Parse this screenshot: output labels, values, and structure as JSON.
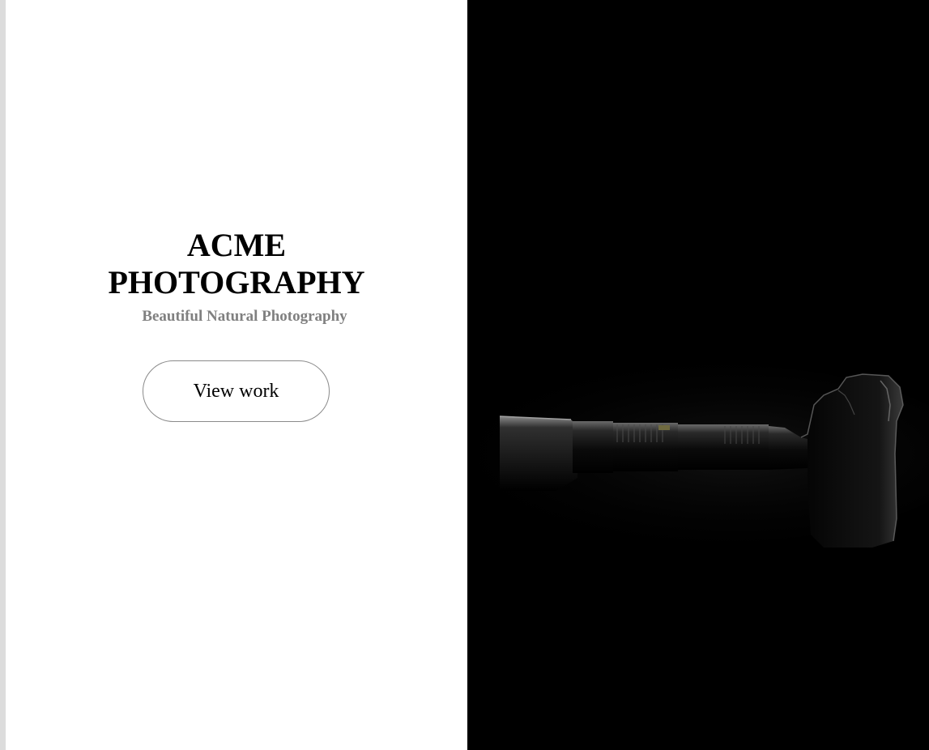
{
  "hero": {
    "title_line1": "ACME",
    "title_line2": "PHOTOGRAPHY",
    "subtitle": "Beautiful Natural Photography",
    "button_label": "View work"
  },
  "colors": {
    "left_background": "#ffffff",
    "right_background": "#000000",
    "subtitle": "#808080",
    "button_border": "#8a8a8a"
  },
  "icons": {
    "hero_image": "camera-with-telephoto-lens-silhouette"
  }
}
